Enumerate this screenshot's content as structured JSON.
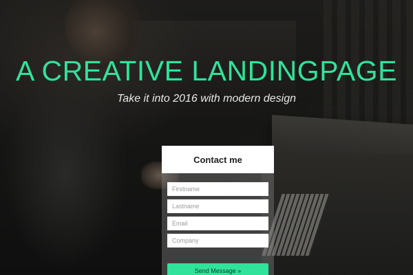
{
  "hero": {
    "title": "A CREATIVE LANDINGPAGE",
    "subtitle": "Take it into 2016 with modern design"
  },
  "contact_form": {
    "title": "Contact me",
    "fields": [
      {
        "placeholder": "Firstname",
        "value": ""
      },
      {
        "placeholder": "Lastname",
        "value": ""
      },
      {
        "placeholder": "Email",
        "value": ""
      },
      {
        "placeholder": "Company",
        "value": ""
      }
    ],
    "submit_label": "Send Message »"
  },
  "colors": {
    "accent": "#2fe39a",
    "background": "#151514",
    "card_header": "#ffffff"
  }
}
